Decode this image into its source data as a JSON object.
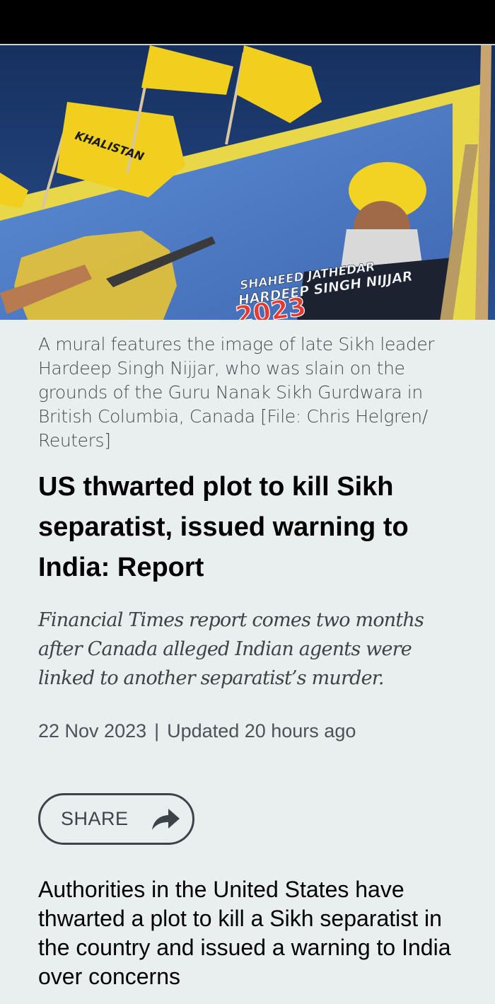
{
  "hero_image": {
    "flag_text": "KHALISTAN",
    "billboard_line1": "SHAHEED JATHEDAR",
    "billboard_line2": "HARDEEP SINGH NIJJAR",
    "billboard_year": "2023",
    "colors": {
      "sky": "#1c3a6e",
      "flag": "#f1cf1f",
      "billboard_border": "#e9d74a",
      "billboard_panel": "#5f86c9"
    }
  },
  "article": {
    "caption": "A mural features the image of late Sikh leader Hardeep Singh Nijjar, who was slain on the grounds of the Guru Nanak Sikh Gurdwara in British Columbia, Canada [File: Chris Helgren/ Reuters]",
    "headline": "US thwarted plot to kill Sikh separatist, issued warning to India: Report",
    "subhead": "Financial Times report comes two months after Canada alleged Indian agents were linked to another separatist’s murder.",
    "date": "22 Nov 2023",
    "separator": "|",
    "updated": "Updated 20 hours ago",
    "share_label": "SHARE",
    "share_icon": "share-arrow-icon",
    "body": "Authorities in the United States have thwarted a plot to kill a Sikh separatist in the country and issued a warning to India over concerns"
  }
}
